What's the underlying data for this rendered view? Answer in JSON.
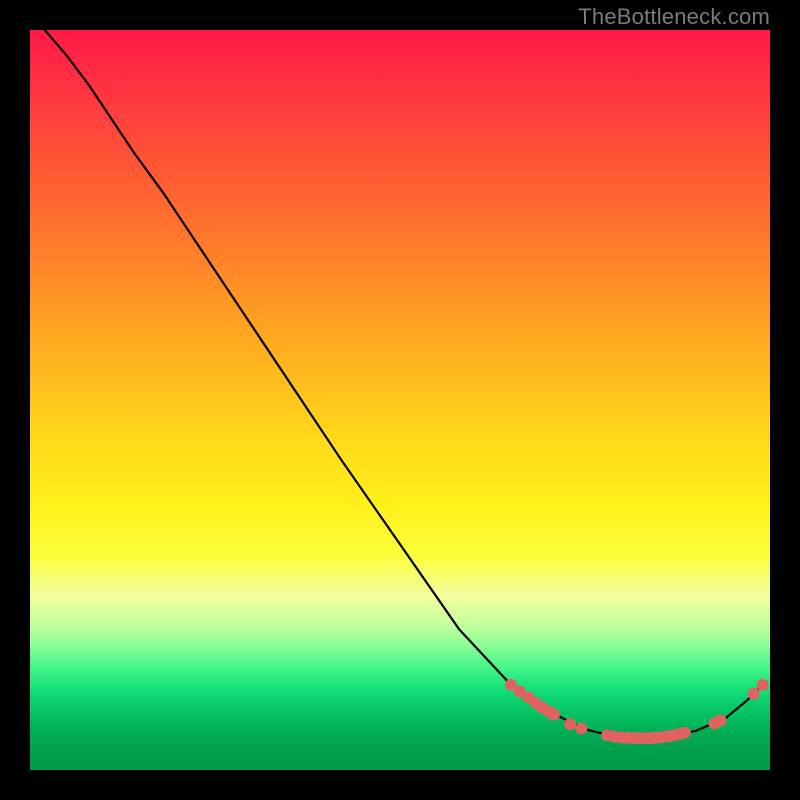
{
  "watermark": "TheBottleneck.com",
  "chart_data": {
    "type": "line",
    "title": "",
    "xlabel": "",
    "ylabel": "",
    "xlim": [
      0,
      100
    ],
    "ylim": [
      0,
      100
    ],
    "grid": false,
    "legend": false,
    "curve": [
      {
        "x": 2.0,
        "y": 100.0
      },
      {
        "x": 5.0,
        "y": 96.5
      },
      {
        "x": 8.0,
        "y": 92.5
      },
      {
        "x": 11.0,
        "y": 88.0
      },
      {
        "x": 14.0,
        "y": 83.5
      },
      {
        "x": 18.0,
        "y": 78.0
      },
      {
        "x": 22.0,
        "y": 72.0
      },
      {
        "x": 28.0,
        "y": 63.0
      },
      {
        "x": 35.0,
        "y": 52.5
      },
      {
        "x": 42.0,
        "y": 42.0
      },
      {
        "x": 50.0,
        "y": 30.5
      },
      {
        "x": 58.0,
        "y": 19.0
      },
      {
        "x": 65.0,
        "y": 11.5
      },
      {
        "x": 70.0,
        "y": 8.0
      },
      {
        "x": 75.0,
        "y": 5.5
      },
      {
        "x": 80.0,
        "y": 4.3
      },
      {
        "x": 85.0,
        "y": 4.3
      },
      {
        "x": 90.0,
        "y": 5.3
      },
      {
        "x": 94.0,
        "y": 7.0
      },
      {
        "x": 97.0,
        "y": 9.5
      },
      {
        "x": 99.0,
        "y": 11.5
      }
    ],
    "markers": [
      {
        "x": 65.0,
        "y": 11.5
      },
      {
        "x": 66.2,
        "y": 10.6
      },
      {
        "x": 67.4,
        "y": 9.8
      },
      {
        "x": 68.4,
        "y": 9.0
      },
      {
        "x": 69.3,
        "y": 8.4
      },
      {
        "x": 70.1,
        "y": 7.9
      },
      {
        "x": 70.8,
        "y": 7.5
      },
      {
        "x": 73.0,
        "y": 6.2
      },
      {
        "x": 74.5,
        "y": 5.6
      },
      {
        "x": 78.0,
        "y": 4.7
      },
      {
        "x": 79.0,
        "y": 4.5
      },
      {
        "x": 80.0,
        "y": 4.4
      },
      {
        "x": 80.8,
        "y": 4.35
      },
      {
        "x": 81.6,
        "y": 4.3
      },
      {
        "x": 82.3,
        "y": 4.3
      },
      {
        "x": 83.0,
        "y": 4.3
      },
      {
        "x": 83.7,
        "y": 4.3
      },
      {
        "x": 84.4,
        "y": 4.35
      },
      {
        "x": 85.1,
        "y": 4.4
      },
      {
        "x": 85.8,
        "y": 4.5
      },
      {
        "x": 86.5,
        "y": 4.6
      },
      {
        "x": 87.2,
        "y": 4.75
      },
      {
        "x": 87.9,
        "y": 4.9
      },
      {
        "x": 88.5,
        "y": 5.05
      },
      {
        "x": 92.5,
        "y": 6.3
      },
      {
        "x": 93.3,
        "y": 6.7
      },
      {
        "x": 97.8,
        "y": 10.3
      },
      {
        "x": 99.0,
        "y": 11.5
      }
    ],
    "marker_color": "#e0635f",
    "curve_color": "#000000"
  }
}
